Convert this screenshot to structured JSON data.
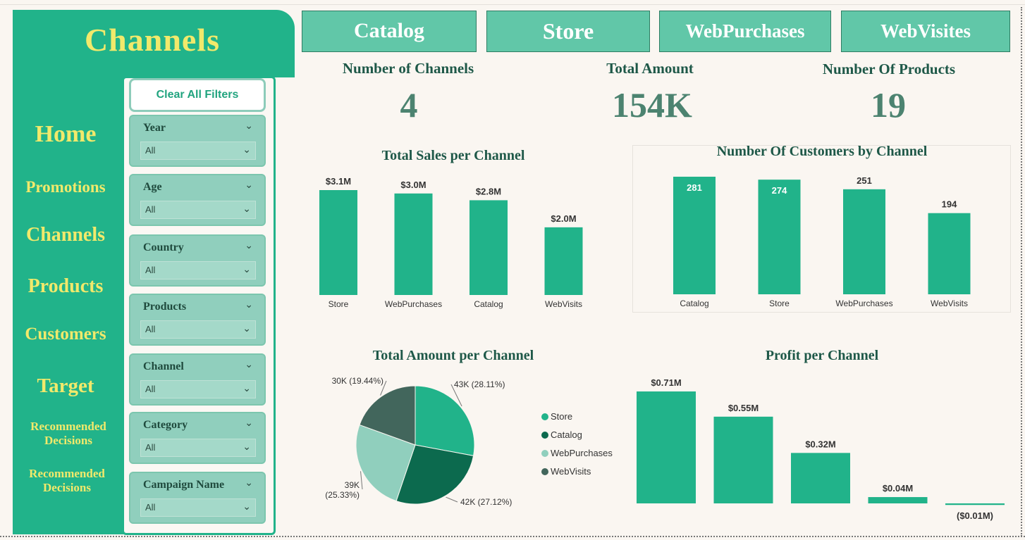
{
  "app": {
    "title": "Channels",
    "nav": [
      {
        "label": "Home",
        "name": "nav-home"
      },
      {
        "label": "Promotions",
        "name": "nav-promotions"
      },
      {
        "label": "Channels",
        "name": "nav-channels"
      },
      {
        "label": "Products",
        "name": "nav-products"
      },
      {
        "label": "Customers",
        "name": "nav-customers"
      },
      {
        "label": "Target",
        "name": "nav-target"
      },
      {
        "label": "Recommended Decisions",
        "name": "nav-recommended-decisions-1"
      },
      {
        "label": "Recommended Decisions",
        "name": "nav-recommended-decisions-2"
      }
    ]
  },
  "filters": {
    "clear_label": "Clear All Filters",
    "slicers": [
      {
        "label": "Year",
        "value": "All"
      },
      {
        "label": "Age",
        "value": "All"
      },
      {
        "label": "Country",
        "value": "All"
      },
      {
        "label": "Products",
        "value": "All"
      },
      {
        "label": "Channel",
        "value": "All"
      },
      {
        "label": "Category",
        "value": "All"
      },
      {
        "label": "Campaign Name",
        "value": "All"
      }
    ]
  },
  "channel_buttons": [
    "Catalog",
    "Store",
    "WebPurchases",
    "WebVisites"
  ],
  "kpis": [
    {
      "label": "Number of Channels",
      "value": "4"
    },
    {
      "label": "Total Amount",
      "value": "154K"
    },
    {
      "label": "Number Of Products",
      "value": "19"
    }
  ],
  "colors": {
    "accent": "#21b38a",
    "title_yellow": "#f1e96b",
    "store": "#21b38a",
    "catalog": "#0c6a4e",
    "webpurchases": "#90cfbd",
    "webvisits": "#42665c"
  },
  "chart_data": [
    {
      "id": "sales",
      "type": "bar",
      "title": "Total Sales per Channel",
      "categories": [
        "Store",
        "WebPurchases",
        "Catalog",
        "WebVisits"
      ],
      "values": [
        3.1,
        3.0,
        2.8,
        2.0
      ],
      "labels": [
        "$3.1M",
        "$3.0M",
        "$2.8M",
        "$2.0M"
      ],
      "unit": "$M"
    },
    {
      "id": "customers",
      "type": "bar",
      "title": "Number Of Customers by Channel",
      "categories": [
        "Catalog",
        "Store",
        "WebPurchases",
        "WebVisits"
      ],
      "values": [
        281,
        274,
        251,
        194
      ],
      "labels": [
        "281",
        "274",
        "251",
        "194"
      ]
    },
    {
      "id": "amount",
      "type": "pie",
      "title": "Total Amount per Channel",
      "categories": [
        "Store",
        "Catalog",
        "WebPurchases",
        "WebVisits"
      ],
      "values": [
        43,
        42,
        39,
        30
      ],
      "percent": [
        28.11,
        27.12,
        25.33,
        19.44
      ],
      "labels": [
        "43K (28.11%)",
        "42K (27.12%)",
        "39K (25.33%)",
        "30K (19.44%)"
      ],
      "legend": [
        "Store",
        "Catalog",
        "WebPurchases",
        "WebVisits"
      ],
      "legend_position": "right"
    },
    {
      "id": "profit",
      "type": "bar",
      "title": "Profit per Channel",
      "categories": [
        "",
        "",
        "",
        "",
        ""
      ],
      "values": [
        0.71,
        0.55,
        0.32,
        0.04,
        -0.01
      ],
      "labels": [
        "$0.71M",
        "$0.55M",
        "$0.32M",
        "$0.04M",
        "($0.01M)"
      ],
      "unit": "$M"
    }
  ]
}
